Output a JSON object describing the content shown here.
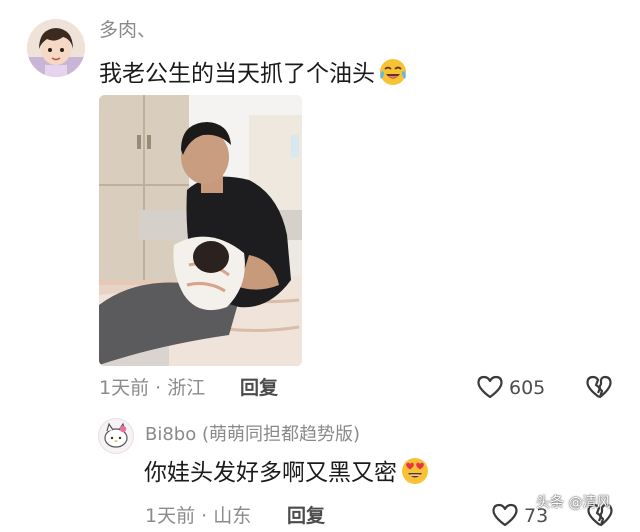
{
  "comment_main": {
    "username": "多肉、",
    "text": "我老公生的当天抓了个油头",
    "emoji": "crying-laughing-face-icon",
    "photo": "man-holding-newborn-photo",
    "meta": "1天前 · 浙江",
    "reply_label": "回复",
    "like_count": "605"
  },
  "comment_reply": {
    "username": "Bi8bo (萌萌同担都趋势版)",
    "text": "你娃头发好多啊又黑又密",
    "emoji": "heart-eyes-face-icon",
    "meta": "1天前 · 山东",
    "reply_label": "回复",
    "like_count": "73"
  },
  "watermark": "头条 @清风",
  "colors": {
    "meta_gray": "#8b8b8b",
    "text": "#1b1b1b",
    "emoji_yellow": "#f7c236",
    "heart_red": "#e8344a"
  }
}
